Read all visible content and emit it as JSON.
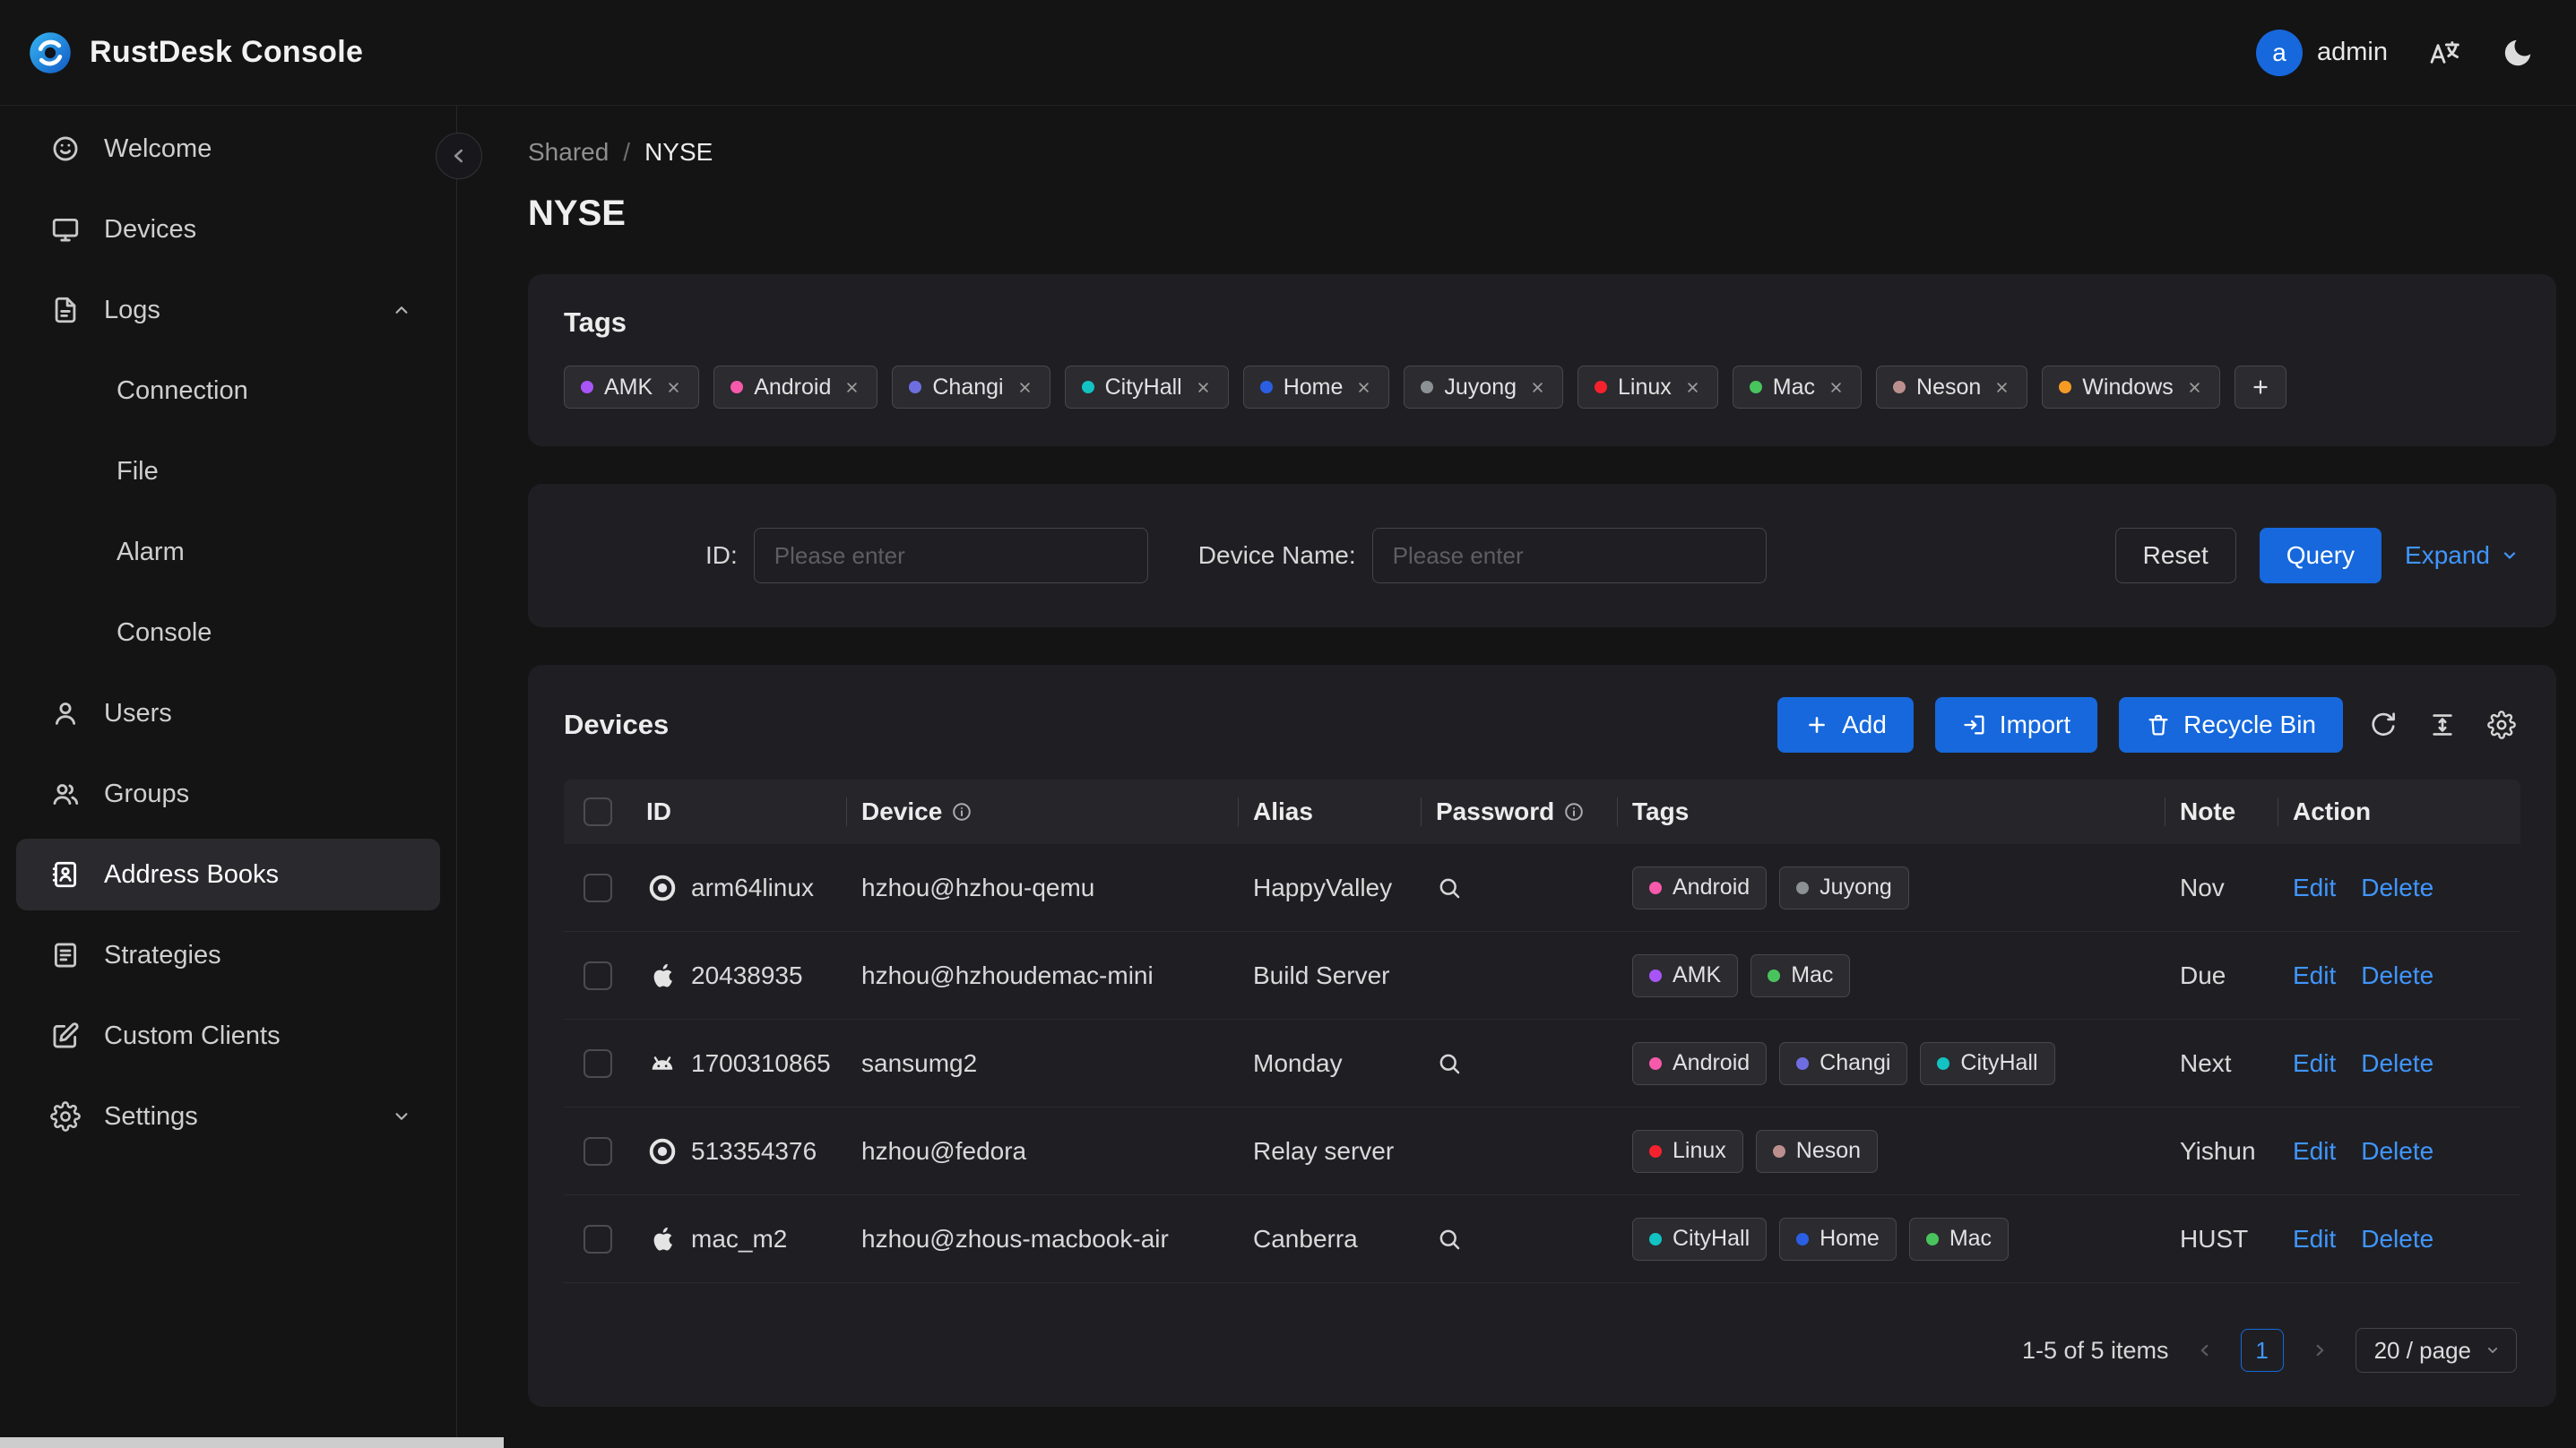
{
  "header": {
    "app_title": "RustDesk Console",
    "user": {
      "initial": "a",
      "name": "admin"
    }
  },
  "sidebar": {
    "items": [
      {
        "label": "Welcome"
      },
      {
        "label": "Devices"
      },
      {
        "label": "Logs"
      },
      {
        "label": "Connection"
      },
      {
        "label": "File"
      },
      {
        "label": "Alarm"
      },
      {
        "label": "Console"
      },
      {
        "label": "Users"
      },
      {
        "label": "Groups"
      },
      {
        "label": "Address Books"
      },
      {
        "label": "Strategies"
      },
      {
        "label": "Custom Clients"
      },
      {
        "label": "Settings"
      }
    ]
  },
  "breadcrumb": {
    "root": "Shared",
    "separator": "/",
    "current": "NYSE"
  },
  "page": {
    "title": "NYSE"
  },
  "tags_card": {
    "title": "Tags",
    "tags": [
      {
        "label": "AMK",
        "color": "#a855f7"
      },
      {
        "label": "Android",
        "color": "#f759ab"
      },
      {
        "label": "Changi",
        "color": "#6e6ee0"
      },
      {
        "label": "CityHall",
        "color": "#13c2c2"
      },
      {
        "label": "Home",
        "color": "#2b5fe3"
      },
      {
        "label": "Juyong",
        "color": "#8c9196"
      },
      {
        "label": "Linux",
        "color": "#f5222d"
      },
      {
        "label": "Mac",
        "color": "#49c45c"
      },
      {
        "label": "Neson",
        "color": "#bc8f8f"
      },
      {
        "label": "Windows",
        "color": "#f59b23"
      }
    ]
  },
  "filter": {
    "id_label": "ID:",
    "id_placeholder": "Please enter",
    "device_label": "Device Name:",
    "device_placeholder": "Please enter",
    "reset_label": "Reset",
    "query_label": "Query",
    "expand_label": "Expand"
  },
  "devices": {
    "title": "Devices",
    "toolbar": {
      "add_label": "Add",
      "import_label": "Import",
      "recycle_label": "Recycle Bin"
    },
    "table": {
      "headers": {
        "id": "ID",
        "device": "Device",
        "alias": "Alias",
        "password": "Password",
        "tags": "Tags",
        "note": "Note",
        "action": "Action"
      },
      "edit_label": "Edit",
      "delete_label": "Delete",
      "rows": [
        {
          "os": "linux",
          "id": "arm64linux",
          "device": "hzhou@hzhou-qemu",
          "alias": "HappyValley",
          "has_password": true,
          "tags": [
            {
              "label": "Android",
              "color": "#f759ab"
            },
            {
              "label": "Juyong",
              "color": "#8c9196"
            }
          ],
          "note": "Nov"
        },
        {
          "os": "mac",
          "id": "20438935",
          "device": "hzhou@hzhoudemac-mini",
          "alias": "Build Server",
          "has_password": false,
          "tags": [
            {
              "label": "AMK",
              "color": "#a855f7"
            },
            {
              "label": "Mac",
              "color": "#49c45c"
            }
          ],
          "note": "Due"
        },
        {
          "os": "android",
          "id": "1700310865",
          "device": "sansumg2",
          "alias": "Monday",
          "has_password": true,
          "tags": [
            {
              "label": "Android",
              "color": "#f759ab"
            },
            {
              "label": "Changi",
              "color": "#6e6ee0"
            },
            {
              "label": "CityHall",
              "color": "#13c2c2"
            }
          ],
          "note": "Next"
        },
        {
          "os": "linux",
          "id": "513354376",
          "device": "hzhou@fedora",
          "alias": "Relay server",
          "has_password": false,
          "tags": [
            {
              "label": "Linux",
              "color": "#f5222d"
            },
            {
              "label": "Neson",
              "color": "#bc8f8f"
            }
          ],
          "note": "Yishun"
        },
        {
          "os": "mac",
          "id": "mac_m2",
          "device": "hzhou@zhous-macbook-air",
          "alias": "Canberra",
          "has_password": true,
          "tags": [
            {
              "label": "CityHall",
              "color": "#13c2c2"
            },
            {
              "label": "Home",
              "color": "#2b5fe3"
            },
            {
              "label": "Mac",
              "color": "#49c45c"
            }
          ],
          "note": "HUST"
        }
      ]
    },
    "pagination": {
      "total_text": "1-5 of 5 items",
      "current_page": "1",
      "page_size": "20 / page"
    }
  }
}
